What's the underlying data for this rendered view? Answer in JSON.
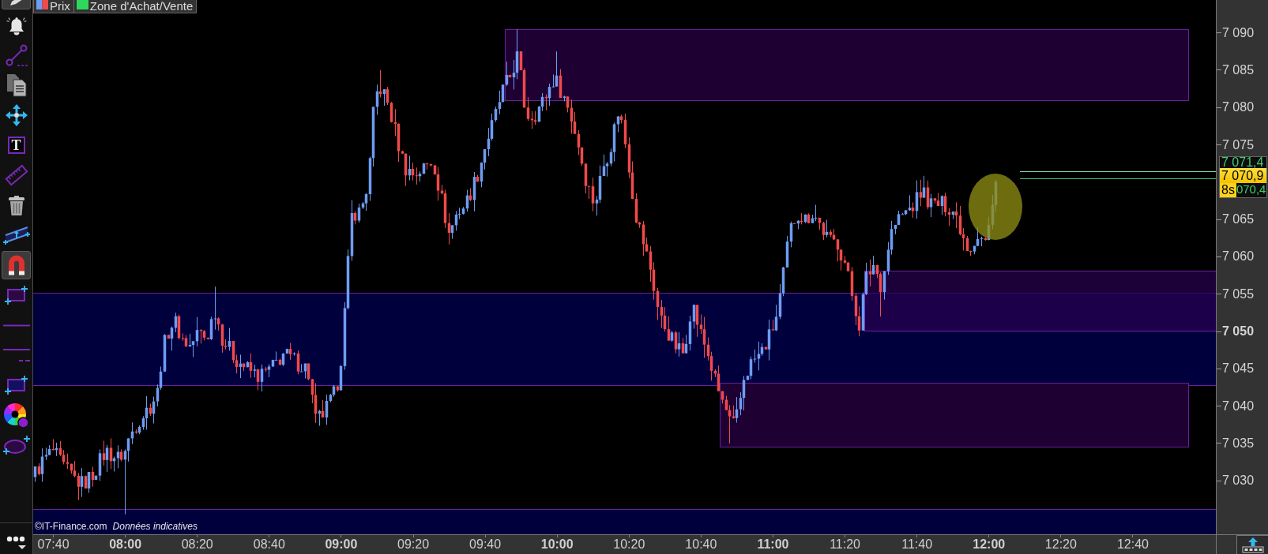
{
  "legend": [
    {
      "kind": "price",
      "label": "Prix"
    },
    {
      "kind": "zone",
      "label": "Zone d'Achat/Vente"
    }
  ],
  "toolbar": {
    "tools": [
      {
        "kind": "pen",
        "selected": true
      },
      {
        "kind": "bell",
        "selected": false
      },
      {
        "kind": "trend-line",
        "selected": false
      },
      {
        "kind": "documents",
        "selected": false
      },
      {
        "kind": "move",
        "selected": false
      },
      {
        "kind": "text",
        "glyph": "T",
        "selected": false
      },
      {
        "kind": "ruler",
        "selected": false
      },
      {
        "kind": "trash",
        "selected": false
      },
      {
        "kind": "channel",
        "selected": false
      },
      {
        "kind": "magnet",
        "selected": true
      },
      {
        "kind": "rectangle",
        "selected": false
      },
      {
        "kind": "horizontal-line",
        "selected": false
      },
      {
        "kind": "line-extension",
        "selected": false
      },
      {
        "kind": "zone-band",
        "selected": false
      },
      {
        "kind": "color-wheel",
        "selected": false
      },
      {
        "kind": "ellipse",
        "selected": false
      }
    ]
  },
  "credits": {
    "source": "©IT-Finance.com",
    "note": "Données indicatives"
  },
  "price_axis": [
    {
      "kind": "tick",
      "label": "7 090",
      "bold": false
    },
    {
      "kind": "tick",
      "label": "7 085",
      "bold": false
    },
    {
      "kind": "tick",
      "label": "7 080",
      "bold": false
    },
    {
      "kind": "tick",
      "label": "7 075",
      "bold": false
    },
    {
      "kind": "quotes",
      "ask": "7 071,4",
      "last": "7 070,9",
      "timer": "8s",
      "bid": "070,4"
    },
    {
      "kind": "tick",
      "label": "7 065",
      "bold": false
    },
    {
      "kind": "tick",
      "label": "7 060",
      "bold": false
    },
    {
      "kind": "tick",
      "label": "7 055",
      "bold": false
    },
    {
      "kind": "tick",
      "label": "7 050",
      "bold": true
    },
    {
      "kind": "tick",
      "label": "7 045",
      "bold": false
    },
    {
      "kind": "tick",
      "label": "7 040",
      "bold": false
    },
    {
      "kind": "tick",
      "label": "7 035",
      "bold": false
    },
    {
      "kind": "tick",
      "label": "7 030",
      "bold": false
    }
  ],
  "time_axis": [
    {
      "label": "07:40",
      "bold": false
    },
    {
      "label": "08:00",
      "bold": true
    },
    {
      "label": "08:20",
      "bold": false
    },
    {
      "label": "08:40",
      "bold": false
    },
    {
      "label": "09:00",
      "bold": true
    },
    {
      "label": "09:20",
      "bold": false
    },
    {
      "label": "09:40",
      "bold": false
    },
    {
      "label": "10:00",
      "bold": true
    },
    {
      "label": "10:20",
      "bold": false
    },
    {
      "label": "10:40",
      "bold": false
    },
    {
      "label": "11:00",
      "bold": true
    },
    {
      "label": "11:20",
      "bold": false
    },
    {
      "label": "11:40",
      "bold": false
    },
    {
      "label": "12:00",
      "bold": true
    },
    {
      "label": "12:20",
      "bold": false
    },
    {
      "label": "12:40",
      "bold": false
    }
  ]
}
